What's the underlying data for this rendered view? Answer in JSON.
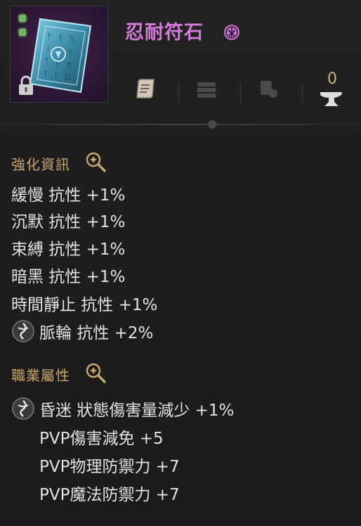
{
  "item": {
    "name": "忍耐符石",
    "enchant_level": "0"
  },
  "colors": {
    "item_name": "#d47ad8",
    "section_title": "#c8a66b",
    "stat_text": "#e2e2e2",
    "background": "#1c1c1c"
  },
  "icons": {
    "header": [
      "item-icon",
      "lock-icon",
      "grade-icon"
    ],
    "actions": [
      "scroll-icon",
      "stack-icon",
      "slot-icon",
      "anvil-icon"
    ]
  },
  "enhance_section": {
    "title": "強化資訊",
    "stats": [
      {
        "label": "緩慢 抗性 +1%"
      },
      {
        "label": "沉默 抗性 +1%"
      },
      {
        "label": "束縛 抗性 +1%"
      },
      {
        "label": "暗黑 抗性 +1%"
      },
      {
        "label": "時間靜止 抗性 +1%"
      },
      {
        "label": "脈輪 抗性 +2%"
      }
    ]
  },
  "class_section": {
    "title": "職業屬性",
    "stats": [
      {
        "label": "昏迷 狀態傷害量減少 +1%"
      },
      {
        "label": "PVP傷害減免 +5"
      },
      {
        "label": "PVP物理防禦力 +7"
      },
      {
        "label": "PVP魔法防禦力 +7"
      }
    ]
  }
}
